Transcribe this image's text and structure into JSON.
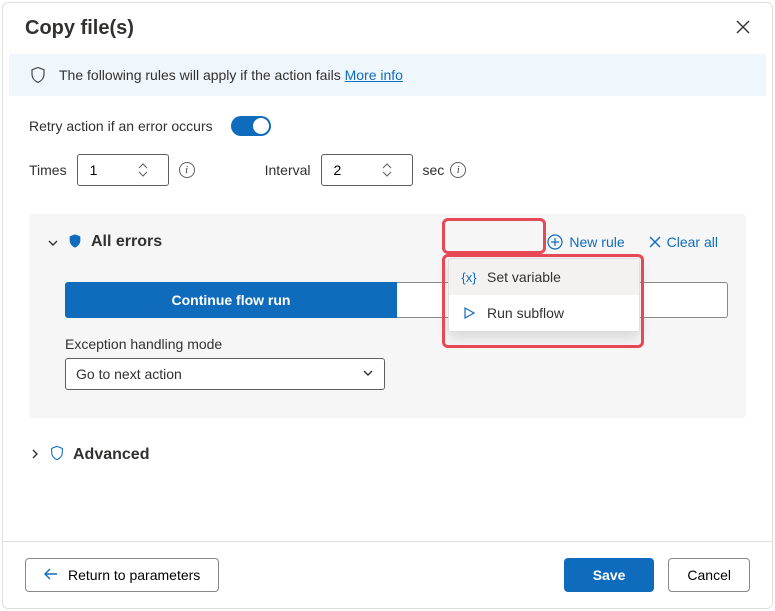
{
  "dialog": {
    "title": "Copy file(s)"
  },
  "infoBar": {
    "text": "The following rules will apply if the action fails ",
    "linkText": "More info"
  },
  "retry": {
    "label": "Retry action if an error occurs",
    "toggleOn": true,
    "timesLabel": "Times",
    "timesValue": "1",
    "intervalLabel": "Interval",
    "intervalValue": "2",
    "unit": "sec"
  },
  "panel": {
    "allErrors": "All errors",
    "newRule": "New rule",
    "clearAll": "Clear all",
    "segPrimary": "Continue flow run",
    "segSecondary": "",
    "modeLabel": "Exception handling mode",
    "modeValue": "Go to next action"
  },
  "menu": {
    "items": [
      {
        "icon": "braces",
        "label": "Set variable"
      },
      {
        "icon": "play",
        "label": "Run subflow"
      }
    ]
  },
  "advanced": {
    "label": "Advanced"
  },
  "footer": {
    "return": "Return to parameters",
    "save": "Save",
    "cancel": "Cancel"
  },
  "colors": {
    "accent": "#0f6cbd",
    "danger": "#e74856"
  }
}
